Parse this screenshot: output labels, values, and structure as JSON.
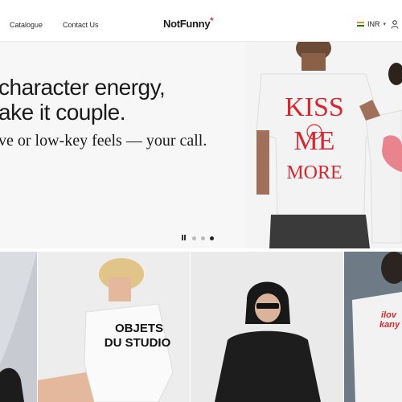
{
  "header": {
    "nav": [
      {
        "label": "Catalogue"
      },
      {
        "label": "Contact Us"
      }
    ],
    "logo": "NotFunny",
    "logo_mark": "*",
    "currency": "INR",
    "icons": {
      "flag": "india-flag-icon",
      "caret": "chevron-down-icon",
      "account": "user-icon"
    }
  },
  "hero": {
    "line1": "character energy,",
    "line2": "ake it couple.",
    "subtitle": "ve or low-key feels — your call.",
    "shirt_print": "KISS ME MORE",
    "slides": {
      "count": 3,
      "active_index": 2,
      "paused": false
    }
  },
  "products": [
    {
      "print": ""
    },
    {
      "print": "OBJETS DU STUDIO"
    },
    {
      "print": ""
    },
    {
      "print": "ilove kanye"
    }
  ],
  "colors": {
    "accent": "#e6252a",
    "text": "#1a1a1a",
    "hero_bg": "#f7f7f7"
  }
}
